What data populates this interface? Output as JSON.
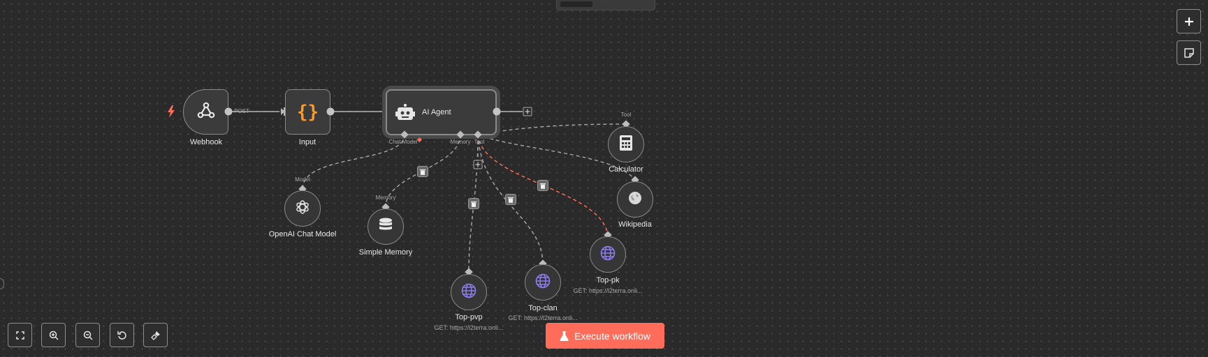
{
  "nodes": {
    "webhook": {
      "label": "Webhook",
      "icon": "webhook-icon"
    },
    "input": {
      "label": "Input",
      "icon": "braces-icon"
    },
    "agent": {
      "label": "AI Agent",
      "icon": "robot-icon"
    },
    "openai": {
      "label": "OpenAI Chat Model",
      "icon": "openai-icon"
    },
    "memory": {
      "label": "Simple Memory",
      "icon": "database-icon"
    },
    "calculator": {
      "label": "Calculator",
      "icon": "calculator-icon"
    },
    "wikipedia": {
      "label": "Wikipedia",
      "icon": "wikipedia-icon"
    },
    "toppk": {
      "label": "Top-pk",
      "sub": "GET: https://l2terra.onli...",
      "icon": "globe-icon"
    },
    "topclan": {
      "label": "Top-clan",
      "sub": "GET: https://l2terra.onli...",
      "icon": "globe-icon"
    },
    "toppvp": {
      "label": "Top-pvp",
      "sub": "GET: https://l2terra.onli...",
      "icon": "globe-icon"
    }
  },
  "edge_labels": {
    "post": "POST",
    "chat_model": "Chat Model",
    "memory": "Memory",
    "tool": "Tool",
    "model": "Model",
    "memory_target": "Memory",
    "tool_target": "Tool"
  },
  "actions": {
    "execute": "Execute workflow"
  },
  "toolbar": {
    "zoom_fit": "fit-view-icon",
    "zoom_in": "zoom-in-icon",
    "zoom_out": "zoom-out-icon",
    "reset": "reset-zoom-icon",
    "tidy": "tidy-up-icon",
    "add_node": "plus-icon",
    "sticky": "sticky-note-icon"
  },
  "colors": {
    "background": "#2a2a2a",
    "accent": "#ff6d5a",
    "trigger": "#ff6d5a",
    "code": "#ff9922",
    "globe": "#8c7df0"
  }
}
